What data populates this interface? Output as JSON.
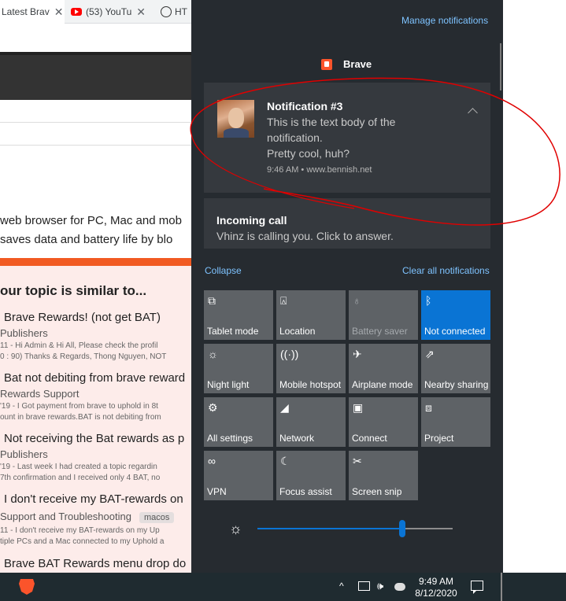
{
  "browser": {
    "tabs": [
      {
        "label": "Latest Brav"
      },
      {
        "label": "(53) YouTu"
      },
      {
        "label": "HT"
      }
    ],
    "page": {
      "text_line1": "web browser for PC, Mac and mob",
      "text_line2": "saves data and battery life by blo",
      "suggest_heading": "our topic is similar to...",
      "topics": [
        {
          "title": "Brave Rewards! (not get BAT)",
          "category": "Publishers",
          "meta1": "11 - Hi Admin & Hi All, Please check the profil",
          "meta2": "0 : 90) Thanks & Regards, Thong Nguyen, NOT"
        },
        {
          "title": "Bat not debiting from brave reward",
          "category": "Rewards Support",
          "meta1": "'19 - I Got payment from brave to uphold in 8t",
          "meta2": "ount in brave rewards.BAT is not debiting from"
        },
        {
          "title": "Not receiving the Bat rewards as p",
          "category": "Publishers",
          "meta1": "'19 - Last week I had created a topic regardin",
          "meta2": "7th confirmation and I received only 4 BAT, no"
        },
        {
          "title": "I don't receive my BAT-rewards on",
          "category": "Support and Troubleshooting",
          "tag": "macos",
          "meta1": "11 - I don't receive my BAT-rewards on my Up",
          "meta2": "tiple PCs and a Mac connected to my Uphold a"
        },
        {
          "title": "Brave BAT Rewards menu drop do"
        }
      ]
    }
  },
  "action_center": {
    "manage_link": "Manage notifications",
    "app_name": "Brave",
    "notification": {
      "title": "Notification #3",
      "body_lines": [
        "This is the text body of the",
        "notification.",
        "Pretty cool, huh?"
      ],
      "meta": "9:46 AM • www.bennish.net"
    },
    "call": {
      "title": "Incoming call",
      "body": "Vhinz is calling you. Click to answer."
    },
    "collapse_label": "Collapse",
    "clear_all_label": "Clear all notifications",
    "tiles": [
      {
        "label": "Tablet mode",
        "icon": "tablet-icon",
        "glyph": "⧉",
        "state": "off"
      },
      {
        "label": "Location",
        "icon": "location-icon",
        "glyph": "⍓",
        "state": "off"
      },
      {
        "label": "Battery saver",
        "icon": "battery-saver-icon",
        "glyph": "♁",
        "state": "disabled"
      },
      {
        "label": "Not connected",
        "icon": "bluetooth-icon",
        "glyph": "ᛒ",
        "state": "on"
      },
      {
        "label": "Night light",
        "icon": "night-light-icon",
        "glyph": "☼",
        "state": "off"
      },
      {
        "label": "Mobile hotspot",
        "icon": "hotspot-icon",
        "glyph": "((·))",
        "state": "off"
      },
      {
        "label": "Airplane mode",
        "icon": "airplane-icon",
        "glyph": "✈",
        "state": "off"
      },
      {
        "label": "Nearby sharing",
        "icon": "nearby-sharing-icon",
        "glyph": "⇗",
        "state": "off"
      },
      {
        "label": "All settings",
        "icon": "gear-icon",
        "glyph": "⚙",
        "state": "off"
      },
      {
        "label": "Network",
        "icon": "network-icon",
        "glyph": "◢",
        "state": "off"
      },
      {
        "label": "Connect",
        "icon": "connect-icon",
        "glyph": "▣",
        "state": "off"
      },
      {
        "label": "Project",
        "icon": "project-icon",
        "glyph": "⧈",
        "state": "off"
      },
      {
        "label": "VPN",
        "icon": "vpn-icon",
        "glyph": "∞",
        "state": "off"
      },
      {
        "label": "Focus assist",
        "icon": "moon-icon",
        "glyph": "☾",
        "state": "off"
      },
      {
        "label": "Screen snip",
        "icon": "scissors-icon",
        "glyph": "✂",
        "state": "off"
      }
    ],
    "brightness": {
      "icon": "brightness-icon",
      "level_percent": 74
    }
  },
  "taskbar": {
    "time": "9:49 AM",
    "date": "8/12/2020"
  },
  "colors": {
    "action_center_bg": "#262b30",
    "tile_bg": "#5e6266",
    "accent": "#0a74d4",
    "link": "#7ec3ff",
    "annotation": "#e00000"
  }
}
